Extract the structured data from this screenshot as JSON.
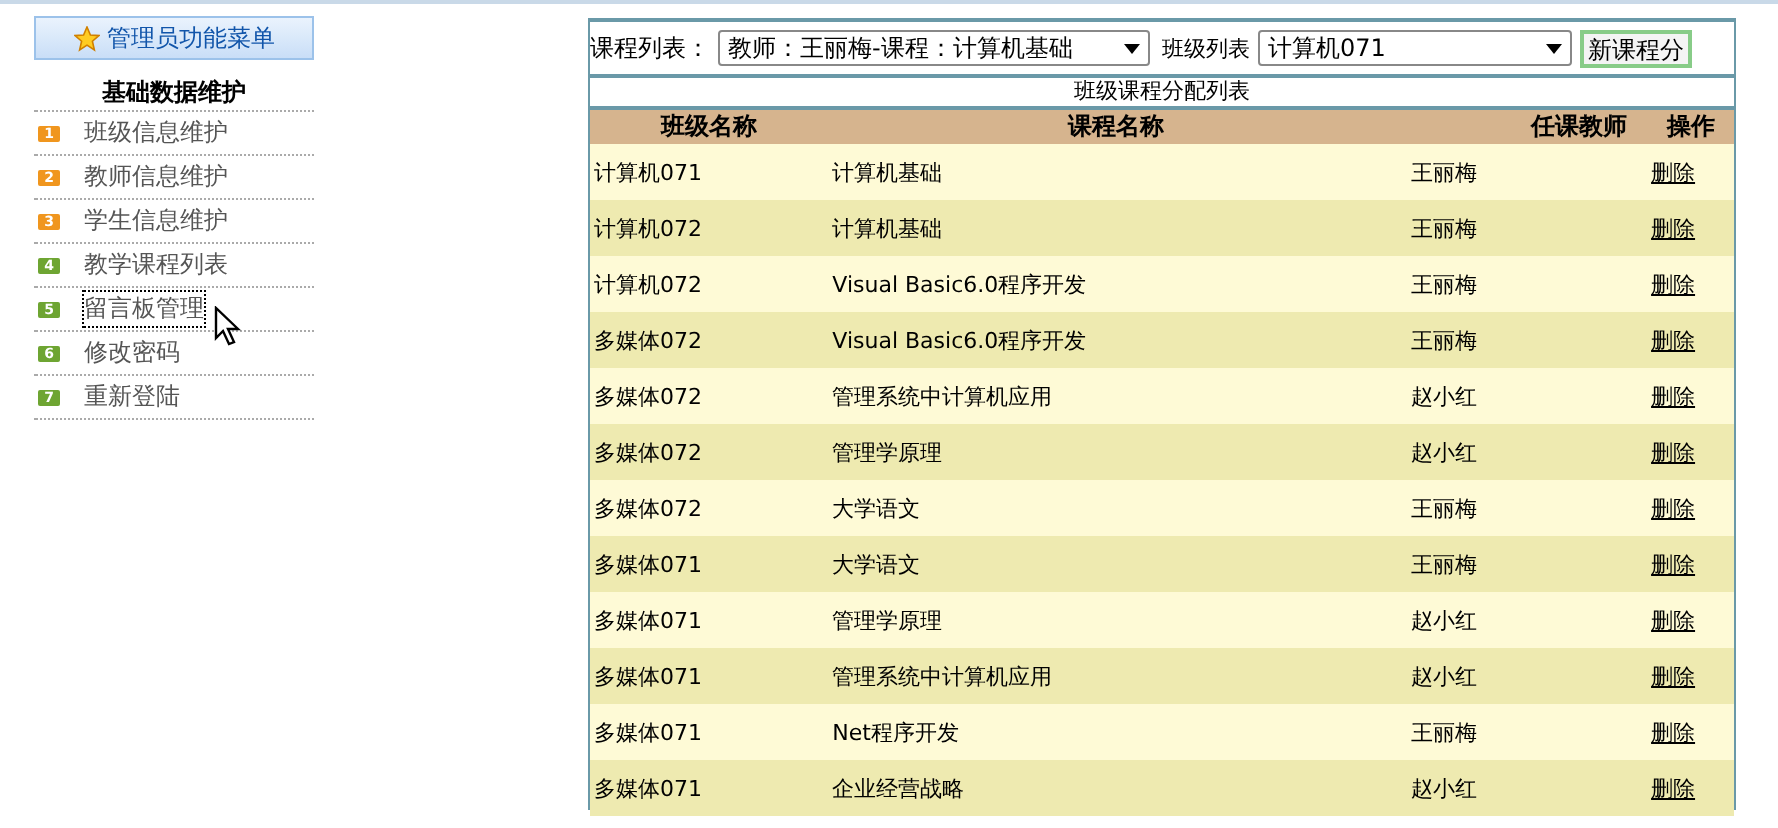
{
  "sidebar": {
    "title": "管理员功能菜单",
    "section": "基础数据维护",
    "items": [
      {
        "badge": "1",
        "label": "班级信息维护",
        "color": "#f0961e",
        "focused": false
      },
      {
        "badge": "2",
        "label": "教师信息维护",
        "color": "#f0961e",
        "focused": false
      },
      {
        "badge": "3",
        "label": "学生信息维护",
        "color": "#f0961e",
        "focused": false
      },
      {
        "badge": "4",
        "label": "教学课程列表",
        "color": "#6ea532",
        "focused": false
      },
      {
        "badge": "5",
        "label": "留言板管理",
        "color": "#6ea532",
        "focused": true
      },
      {
        "badge": "6",
        "label": "修改密码",
        "color": "#6ea532",
        "focused": false
      },
      {
        "badge": "7",
        "label": "重新登陆",
        "color": "#6ea532",
        "focused": false
      }
    ]
  },
  "toolbar": {
    "course_label": "课程列表：",
    "course_value": "教师：王丽梅-课程：计算机基础",
    "class_label": "班级列表",
    "class_value": "计算机071",
    "add_button": "新课程分"
  },
  "table": {
    "caption": "班级课程分配列表",
    "columns": [
      "班级名称",
      "课程名称",
      "任课教师",
      "操作"
    ],
    "rows": [
      [
        "计算机071",
        "计算机基础",
        "王丽梅",
        "删除"
      ],
      [
        "计算机072",
        "计算机基础",
        "王丽梅",
        "删除"
      ],
      [
        "计算机072",
        "Visual Basic6.0程序开发",
        "王丽梅",
        "删除"
      ],
      [
        "多媒体072",
        "Visual Basic6.0程序开发",
        "王丽梅",
        "删除"
      ],
      [
        "多媒体072",
        "管理系统中计算机应用",
        "赵小红",
        "删除"
      ],
      [
        "多媒体072",
        "管理学原理",
        "赵小红",
        "删除"
      ],
      [
        "多媒体072",
        "大学语文",
        "王丽梅",
        "删除"
      ],
      [
        "多媒体071",
        "大学语文",
        "王丽梅",
        "删除"
      ],
      [
        "多媒体071",
        "管理学原理",
        "赵小红",
        "删除"
      ],
      [
        "多媒体071",
        "管理系统中计算机应用",
        "赵小红",
        "删除"
      ],
      [
        "多媒体071",
        "Net程序开发",
        "王丽梅",
        "删除"
      ],
      [
        "多媒体071",
        "企业经营战略",
        "赵小红",
        "删除"
      ]
    ]
  }
}
